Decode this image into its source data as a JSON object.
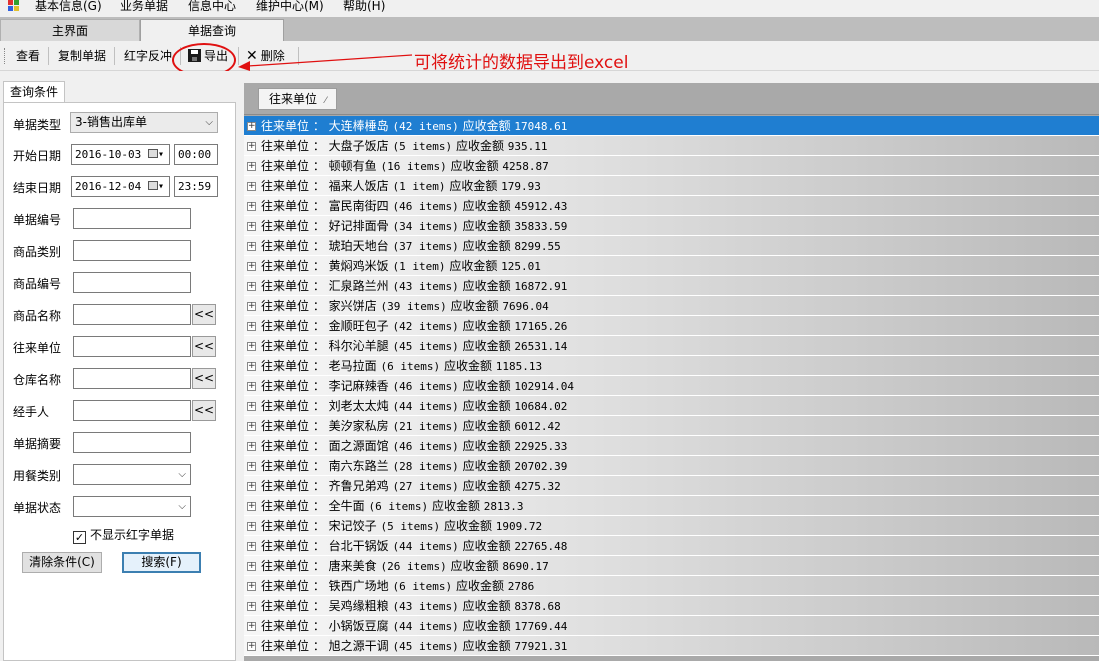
{
  "menu": {
    "items": [
      "基本信息(G)",
      "业务单据",
      "信息中心",
      "维护中心(M)",
      "帮助(H)"
    ]
  },
  "doc_tabs": [
    "主界面",
    "单据查询"
  ],
  "toolbar": {
    "view_label": "查看",
    "copy_label": "复制单据",
    "red_label": "红字反冲",
    "export_label": "导出",
    "delete_label": "删除"
  },
  "annotation": {
    "text": "可将统计的数据导出到excel",
    "color": "#e01010"
  },
  "query": {
    "tab_label": "查询条件",
    "bill_type_label": "单据类型",
    "bill_type_value": "3-销售出库单",
    "start_date_label": "开始日期",
    "start_date": "2016-10-03",
    "start_time": "00:00",
    "end_date_label": "结束日期",
    "end_date": "2016-12-04",
    "end_time": "23:59",
    "bill_no_label": "单据编号",
    "goods_category_label": "商品类别",
    "goods_no_label": "商品编号",
    "goods_name_label": "商品名称",
    "partner_label": "往来单位",
    "warehouse_label": "仓库名称",
    "handler_label": "经手人",
    "summary_label": "单据摘要",
    "meal_type_label": "用餐类别",
    "status_label": "单据状态",
    "hide_red_label": "不显示红字单据",
    "hide_red_checked": true,
    "clear_label": "清除条件(C)",
    "search_label": "搜索(F)",
    "pick_label": "<<"
  },
  "grid": {
    "group_by": "往来单位",
    "prefix": "往来单位 ：",
    "amount_label": "应收金额",
    "selected_color": "#1f7ed1",
    "rows": [
      {
        "name": "大连棒棰岛",
        "count": "(42 items)",
        "amount": "17048.61"
      },
      {
        "name": "大盘子饭店",
        "count": "(5 items)",
        "amount": "935.11"
      },
      {
        "name": "顿顿有鱼",
        "count": "(16 items)",
        "amount": "4258.87"
      },
      {
        "name": "福来人饭店",
        "count": "(1 item)",
        "amount": "179.93"
      },
      {
        "name": "富民南街四",
        "count": "(46 items)",
        "amount": "45912.43"
      },
      {
        "name": "好记排面骨",
        "count": "(34 items)",
        "amount": "35833.59"
      },
      {
        "name": "琥珀天地台",
        "count": "(37 items)",
        "amount": "8299.55"
      },
      {
        "name": "黄焖鸡米饭",
        "count": "(1 item)",
        "amount": "125.01"
      },
      {
        "name": "汇泉路兰州",
        "count": "(43 items)",
        "amount": "16872.91"
      },
      {
        "name": "家兴饼店",
        "count": "(39 items)",
        "amount": "7696.04"
      },
      {
        "name": "金顺旺包子",
        "count": "(42 items)",
        "amount": "17165.26"
      },
      {
        "name": "科尔沁羊腿",
        "count": "(45 items)",
        "amount": "26531.14"
      },
      {
        "name": "老马拉面",
        "count": "(6 items)",
        "amount": "1185.13"
      },
      {
        "name": "李记麻辣香",
        "count": "(46 items)",
        "amount": "102914.04"
      },
      {
        "name": "刘老太太炖",
        "count": "(44 items)",
        "amount": "10684.02"
      },
      {
        "name": "美汐家私房",
        "count": "(21 items)",
        "amount": "6012.42"
      },
      {
        "name": "面之源面馆",
        "count": "(46 items)",
        "amount": "22925.33"
      },
      {
        "name": "南六东路兰",
        "count": "(28 items)",
        "amount": "20702.39"
      },
      {
        "name": "齐鲁兄弟鸡",
        "count": "(27 items)",
        "amount": "4275.32"
      },
      {
        "name": "全牛面",
        "count": "(6 items)",
        "amount": "2813.3"
      },
      {
        "name": "宋记饺子",
        "count": "(5 items)",
        "amount": "1909.72"
      },
      {
        "name": "台北干锅饭",
        "count": "(44 items)",
        "amount": "22765.48"
      },
      {
        "name": "唐来美食",
        "count": "(26 items)",
        "amount": "8690.17"
      },
      {
        "name": "铁西广场地",
        "count": "(6 items)",
        "amount": "2786"
      },
      {
        "name": "吴鸡缘粗粮",
        "count": "(43 items)",
        "amount": "8378.68"
      },
      {
        "name": "小锅饭豆腐",
        "count": "(44 items)",
        "amount": "17769.44"
      },
      {
        "name": "旭之源干调",
        "count": "(45 items)",
        "amount": "77921.31"
      }
    ]
  }
}
